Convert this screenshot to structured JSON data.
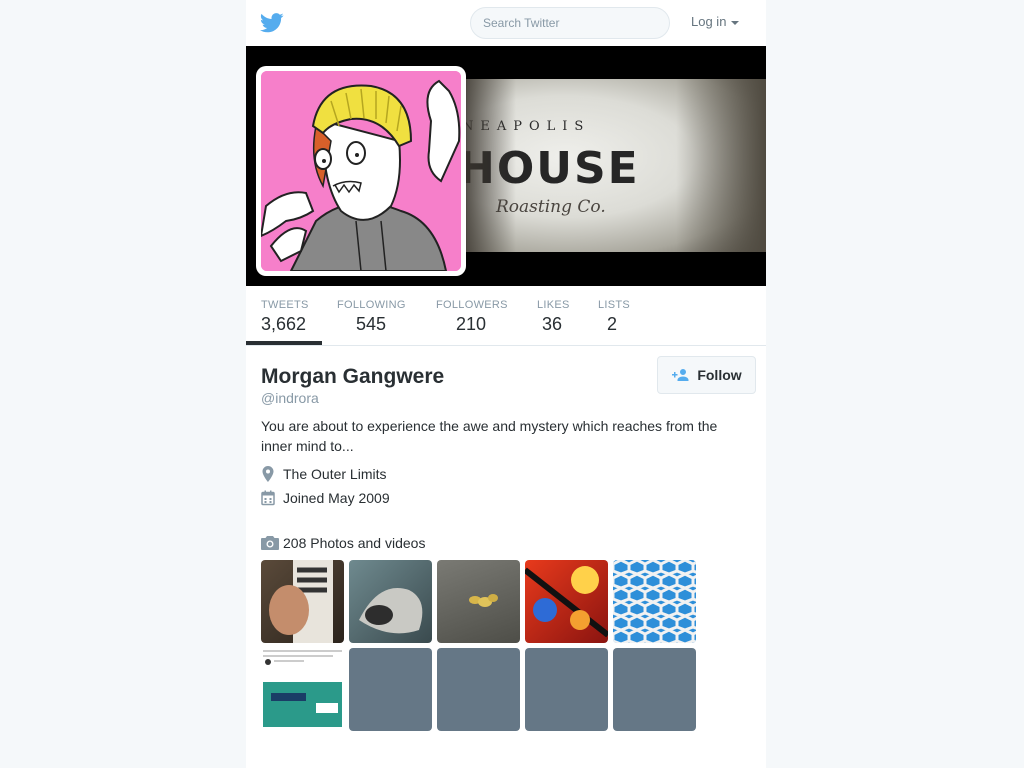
{
  "topbar": {
    "search_placeholder": "Search Twitter",
    "login_label": "Log in",
    "logo_icon": "twitter-bird-icon"
  },
  "banner": {
    "line1": "NEAPOLIS",
    "line2": "HOUSE",
    "line3": "Roasting Co."
  },
  "stats": [
    {
      "label": "TWEETS",
      "value": "3,662"
    },
    {
      "label": "FOLLOWING",
      "value": "545"
    },
    {
      "label": "FOLLOWERS",
      "value": "210"
    },
    {
      "label": "LIKES",
      "value": "36"
    },
    {
      "label": "LISTS",
      "value": "2"
    }
  ],
  "profile": {
    "name": "Morgan Gangwere",
    "handle": "@indrora",
    "bio": "You are about to experience the awe and mystery which reaches from the inner mind to...",
    "location": "The Outer Limits",
    "joined": "Joined May 2009",
    "follow_label": "Follow"
  },
  "media": {
    "title": "208 Photos and videos"
  },
  "colors": {
    "brand": "#55acee",
    "avatar_bg": "#f67fca",
    "hair": "#f0e040",
    "placeholder_thumb": "#657786"
  }
}
